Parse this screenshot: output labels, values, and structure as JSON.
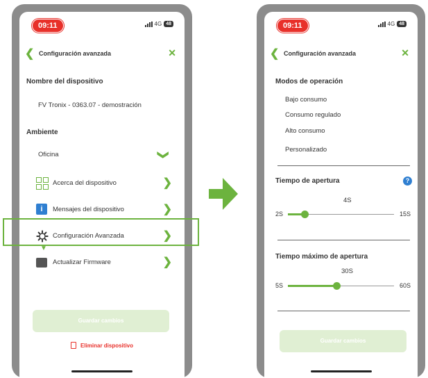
{
  "status": {
    "time": "09:11",
    "network": "4G",
    "battery": "48"
  },
  "left": {
    "nav_title": "Configuración avanzada",
    "device_name_header": "Nombre del dispositivo",
    "device_name_value": "FV Tronix - 0363.07 - demostración",
    "ambient_header": "Ambiente",
    "ambient_value": "Oficina",
    "menu": [
      {
        "label": "Acerca del dispositivo",
        "icon": "grid-icon"
      },
      {
        "label": "Mensajes del dispositivo",
        "icon": "info-icon"
      },
      {
        "label": "Configuración Avanzada",
        "icon": "gear-icon"
      },
      {
        "label": "Actualizar Firmware",
        "icon": "firmware-icon"
      }
    ],
    "info_glyph": "i",
    "save_label": "Guardar cambios",
    "delete_label": "Eliminar dispositivo"
  },
  "right": {
    "nav_title": "Configuración avanzada",
    "modes_header": "Modos de operación",
    "modes": [
      "Bajo consumo",
      "Consumo regulado",
      "Alto consumo",
      "Personalizado"
    ],
    "opening_header": "Tiempo de apertura",
    "help_glyph": "?",
    "opening_slider": {
      "value_label": "4S",
      "min_label": "2S",
      "max_label": "15S",
      "min": 2,
      "max": 15,
      "value": 4
    },
    "max_opening_header": "Tiempo máximo de apertura",
    "max_slider": {
      "value_label": "30S",
      "min_label": "5S",
      "max_label": "60S",
      "min": 5,
      "max": 60,
      "value": 30
    },
    "save_label": "Guardar cambios"
  },
  "colors": {
    "accent": "#6cb33e",
    "danger": "#e8302a",
    "info": "#2f7fd1"
  }
}
